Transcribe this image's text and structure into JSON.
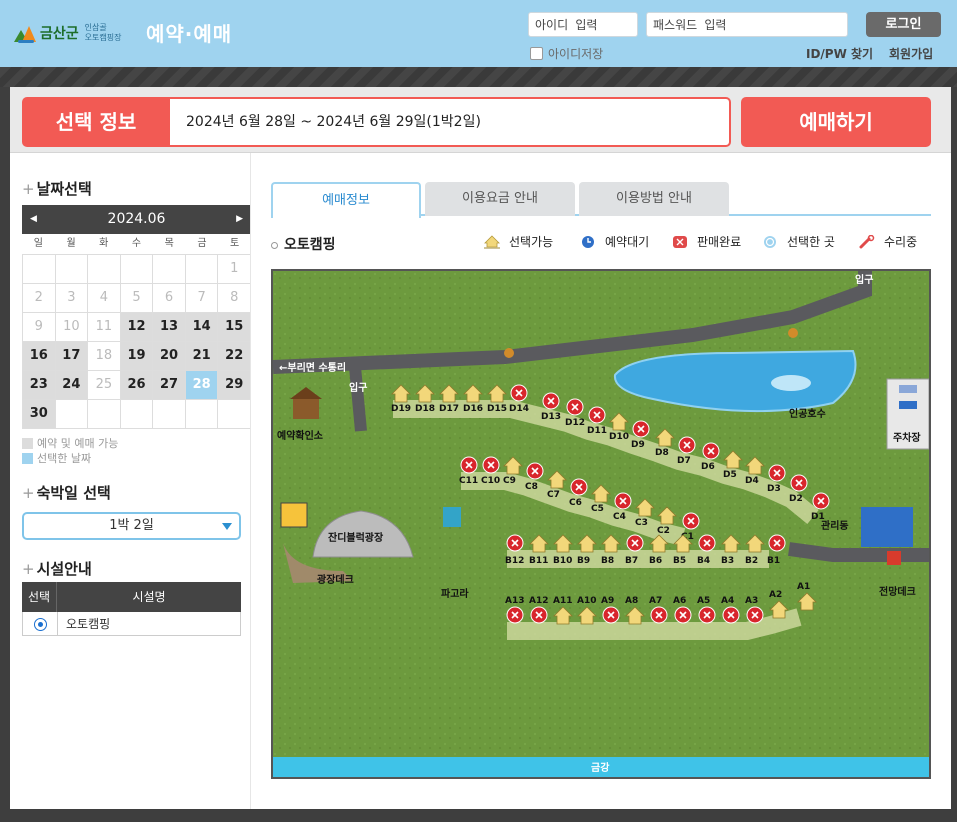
{
  "header": {
    "logo_text": "금산군",
    "logo_sub_1": "인삼골",
    "logo_sub_2": "오토캠핑장",
    "site_title": "예약·예매",
    "id_placeholder": "아이디 입력",
    "pw_placeholder": "패스워드 입력",
    "login_label": "로그인",
    "save_id_label": "아이디저장",
    "find_label": "ID/PW 찾기",
    "join_label": "회원가입"
  },
  "selection": {
    "label": "선택 정보",
    "value": "2024년 6월 28일 ~ 2024년 6월 29일(1박2일)",
    "book_label": "예매하기"
  },
  "date_section": {
    "title": "날짜선택",
    "month": "2024.06",
    "prev_icon": "arrow-left-icon",
    "next_icon": "arrow-right-icon",
    "weekdays": [
      "일",
      "월",
      "화",
      "수",
      "목",
      "금",
      "토"
    ],
    "days": [
      {
        "d": "",
        "s": "emp"
      },
      {
        "d": "",
        "s": "emp"
      },
      {
        "d": "",
        "s": "emp"
      },
      {
        "d": "",
        "s": "emp"
      },
      {
        "d": "",
        "s": "emp"
      },
      {
        "d": "",
        "s": "emp"
      },
      {
        "d": "1",
        "s": "dis"
      },
      {
        "d": "2",
        "s": "dis"
      },
      {
        "d": "3",
        "s": "dis"
      },
      {
        "d": "4",
        "s": "dis"
      },
      {
        "d": "5",
        "s": "dis"
      },
      {
        "d": "6",
        "s": "dis"
      },
      {
        "d": "7",
        "s": "dis"
      },
      {
        "d": "8",
        "s": "dis"
      },
      {
        "d": "9",
        "s": "dis"
      },
      {
        "d": "10",
        "s": "dis"
      },
      {
        "d": "11",
        "s": "dis"
      },
      {
        "d": "12",
        "s": "av"
      },
      {
        "d": "13",
        "s": "av"
      },
      {
        "d": "14",
        "s": "av"
      },
      {
        "d": "15",
        "s": "av"
      },
      {
        "d": "16",
        "s": "av"
      },
      {
        "d": "17",
        "s": "av"
      },
      {
        "d": "18",
        "s": "dis"
      },
      {
        "d": "19",
        "s": "av"
      },
      {
        "d": "20",
        "s": "av"
      },
      {
        "d": "21",
        "s": "av"
      },
      {
        "d": "22",
        "s": "av"
      },
      {
        "d": "23",
        "s": "av"
      },
      {
        "d": "24",
        "s": "av"
      },
      {
        "d": "25",
        "s": "dis"
      },
      {
        "d": "26",
        "s": "av"
      },
      {
        "d": "27",
        "s": "av"
      },
      {
        "d": "28",
        "s": "sel"
      },
      {
        "d": "29",
        "s": "av"
      },
      {
        "d": "30",
        "s": "av"
      },
      {
        "d": "",
        "s": "emp"
      },
      {
        "d": "",
        "s": "emp"
      },
      {
        "d": "",
        "s": "emp"
      },
      {
        "d": "",
        "s": "emp"
      },
      {
        "d": "",
        "s": "emp"
      },
      {
        "d": "",
        "s": "emp"
      }
    ],
    "legend_available": "예약 및 예매 가능",
    "legend_selected": "선택한 날짜",
    "colors": {
      "available": "#dcdcdc",
      "selected": "#9fd3ef"
    }
  },
  "nights_section": {
    "title": "숙박일 선택",
    "value": "1박 2일"
  },
  "facility_section": {
    "title": "시설안내",
    "col_select": "선택",
    "col_name": "시설명",
    "rows": [
      {
        "name": "오토캠핑",
        "selected": true
      }
    ]
  },
  "tabs": [
    "예매정보",
    "이용요금 안내",
    "이용방법 안내"
  ],
  "map": {
    "area_name": "오토캠핑",
    "legend": {
      "available": "선택가능",
      "waiting": "예약대기",
      "soldout": "판매완료",
      "selected": "선택한 곳",
      "repair": "수리중"
    },
    "labels": {
      "entrance1": "입구",
      "entrance2": "입구",
      "road": "←부리면 수통리",
      "office": "예약확인소",
      "lake": "인공호수",
      "parking": "주차장",
      "management": "관리동",
      "plaza": "잔디블럭광장",
      "plaza_deck": "광장데크",
      "pergola": "파고라",
      "view_deck": "전망데크",
      "river": "금강"
    },
    "rows": {
      "D": [
        {
          "n": "D19",
          "s": "a"
        },
        {
          "n": "D18",
          "s": "a"
        },
        {
          "n": "D17",
          "s": "a"
        },
        {
          "n": "D16",
          "s": "a"
        },
        {
          "n": "D15",
          "s": "a"
        },
        {
          "n": "D14",
          "s": "x"
        },
        {
          "n": "D13",
          "s": "x"
        },
        {
          "n": "D12",
          "s": "x"
        },
        {
          "n": "D11",
          "s": "x"
        },
        {
          "n": "D10",
          "s": "a"
        },
        {
          "n": "D9",
          "s": "x"
        },
        {
          "n": "D8",
          "s": "a"
        },
        {
          "n": "D7",
          "s": "x"
        },
        {
          "n": "D6",
          "s": "x"
        },
        {
          "n": "D5",
          "s": "a"
        },
        {
          "n": "D4",
          "s": "a"
        },
        {
          "n": "D3",
          "s": "x"
        },
        {
          "n": "D2",
          "s": "x"
        },
        {
          "n": "D1",
          "s": "x"
        }
      ],
      "C": [
        {
          "n": "C11",
          "s": "x"
        },
        {
          "n": "C10",
          "s": "x"
        },
        {
          "n": "C9",
          "s": "a"
        },
        {
          "n": "C8",
          "s": "x"
        },
        {
          "n": "C7",
          "s": "a"
        },
        {
          "n": "C6",
          "s": "x"
        },
        {
          "n": "C5",
          "s": "a"
        },
        {
          "n": "C4",
          "s": "x"
        },
        {
          "n": "C3",
          "s": "a"
        },
        {
          "n": "C2",
          "s": "a"
        },
        {
          "n": "C1",
          "s": "x"
        }
      ],
      "B": [
        {
          "n": "B12",
          "s": "x"
        },
        {
          "n": "B11",
          "s": "a"
        },
        {
          "n": "B10",
          "s": "a"
        },
        {
          "n": "B9",
          "s": "a"
        },
        {
          "n": "B8",
          "s": "a"
        },
        {
          "n": "B7",
          "s": "x"
        },
        {
          "n": "B6",
          "s": "a"
        },
        {
          "n": "B5",
          "s": "a"
        },
        {
          "n": "B4",
          "s": "x"
        },
        {
          "n": "B3",
          "s": "a"
        },
        {
          "n": "B2",
          "s": "a"
        },
        {
          "n": "B1",
          "s": "x"
        }
      ],
      "A": [
        {
          "n": "A13",
          "s": "x"
        },
        {
          "n": "A12",
          "s": "x"
        },
        {
          "n": "A11",
          "s": "a"
        },
        {
          "n": "A10",
          "s": "a"
        },
        {
          "n": "A9",
          "s": "x"
        },
        {
          "n": "A8",
          "s": "a"
        },
        {
          "n": "A7",
          "s": "x"
        },
        {
          "n": "A6",
          "s": "x"
        },
        {
          "n": "A5",
          "s": "x"
        },
        {
          "n": "A4",
          "s": "x"
        },
        {
          "n": "A3",
          "s": "x"
        },
        {
          "n": "A2",
          "s": "a"
        },
        {
          "n": "A1",
          "s": "a"
        }
      ]
    },
    "colors": {
      "grass": "#6d9a3e",
      "road": "#5a5a5e",
      "lake": "#3fa8e0",
      "soldout": "#d8262c",
      "tent": "#f2d77a"
    }
  }
}
